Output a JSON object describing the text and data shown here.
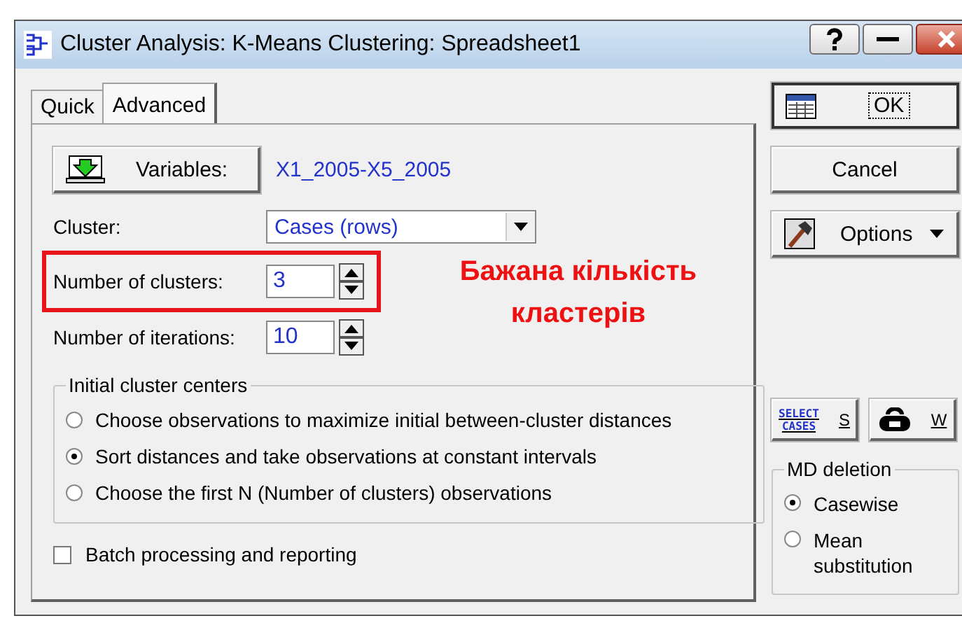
{
  "window": {
    "title": "Cluster Analysis: K-Means Clustering: Spreadsheet1"
  },
  "tabs": [
    {
      "label": "Quick",
      "selected": false
    },
    {
      "label": "Advanced",
      "selected": true
    }
  ],
  "variables": {
    "button": "Variables:",
    "value": "X1_2005-X5_2005"
  },
  "cluster": {
    "label": "Cluster:",
    "value": "Cases (rows)"
  },
  "clusters": {
    "label": "Number of clusters:",
    "value": "3",
    "highlighted": true
  },
  "iterations": {
    "label": "Number of iterations:",
    "value": "10"
  },
  "annotation": "Бажана кількість кластерів",
  "initial_centers": {
    "title": "Initial cluster centers",
    "options": [
      {
        "label": "Choose observations to maximize initial between-cluster distances",
        "selected": false
      },
      {
        "label": "Sort distances and take observations at constant intervals",
        "selected": true
      },
      {
        "label": "Choose the first N (Number of clusters) observations",
        "selected": false
      }
    ]
  },
  "batch": {
    "label": "Batch processing and reporting",
    "checked": false
  },
  "actions": [
    {
      "kind": "ok",
      "label": "OK"
    },
    {
      "kind": "cancel",
      "label": "Cancel"
    },
    {
      "kind": "options",
      "label": "Options"
    }
  ],
  "tools": [
    {
      "kind": "select",
      "icon_text": "SELECT CASES",
      "label": "S"
    },
    {
      "kind": "weight",
      "label": "W"
    }
  ],
  "md_deletion": {
    "title": "MD deletion",
    "options": [
      {
        "label": "Casewise",
        "selected": true
      },
      {
        "label": "Mean substitution",
        "selected": false
      }
    ]
  }
}
